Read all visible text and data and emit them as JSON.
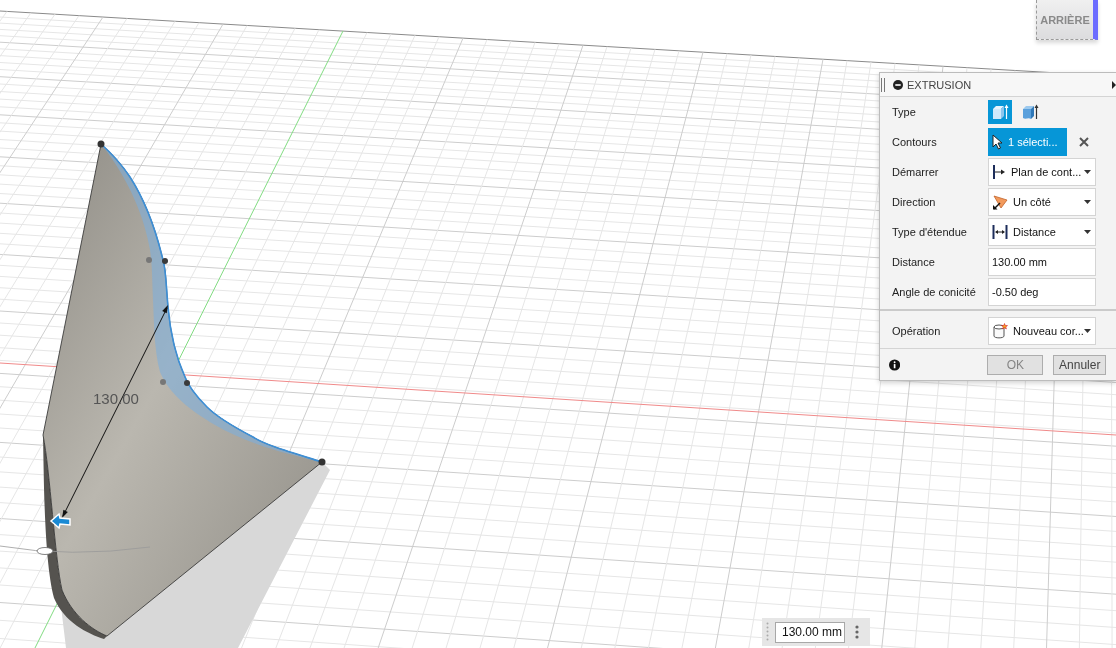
{
  "viewport": {
    "dimension_label": "130.00"
  },
  "view_cube": {
    "label": "ARRIÈRE"
  },
  "dialog": {
    "title": "EXTRUSION",
    "sections": [
      {
        "rows": [
          {
            "kind": "toggle",
            "label": "Type",
            "options": [
              {
                "selected": true
              },
              {
                "selected": false
              }
            ]
          },
          {
            "kind": "selection",
            "label": "Contours",
            "value": "1 sélecti..."
          },
          {
            "kind": "dropdown",
            "label": "Démarrer",
            "value": "Plan de cont..."
          },
          {
            "kind": "dropdown",
            "label": "Direction",
            "value": "Un côté"
          },
          {
            "kind": "dropdown",
            "label": "Type d'étendue",
            "value": "Distance"
          },
          {
            "kind": "input",
            "label": "Distance",
            "value": "130.00 mm"
          },
          {
            "kind": "input",
            "label": "Angle de conicité",
            "value": "-0.50 deg"
          }
        ]
      },
      {
        "rows": [
          {
            "kind": "dropdown",
            "label": "Opération",
            "value": "Nouveau cor..."
          }
        ]
      }
    ],
    "buttons": [
      {
        "label": "OK",
        "disabled": true
      },
      {
        "label": "Annuler",
        "disabled": false
      }
    ]
  },
  "dimension_input": {
    "value": "130.00 mm"
  }
}
